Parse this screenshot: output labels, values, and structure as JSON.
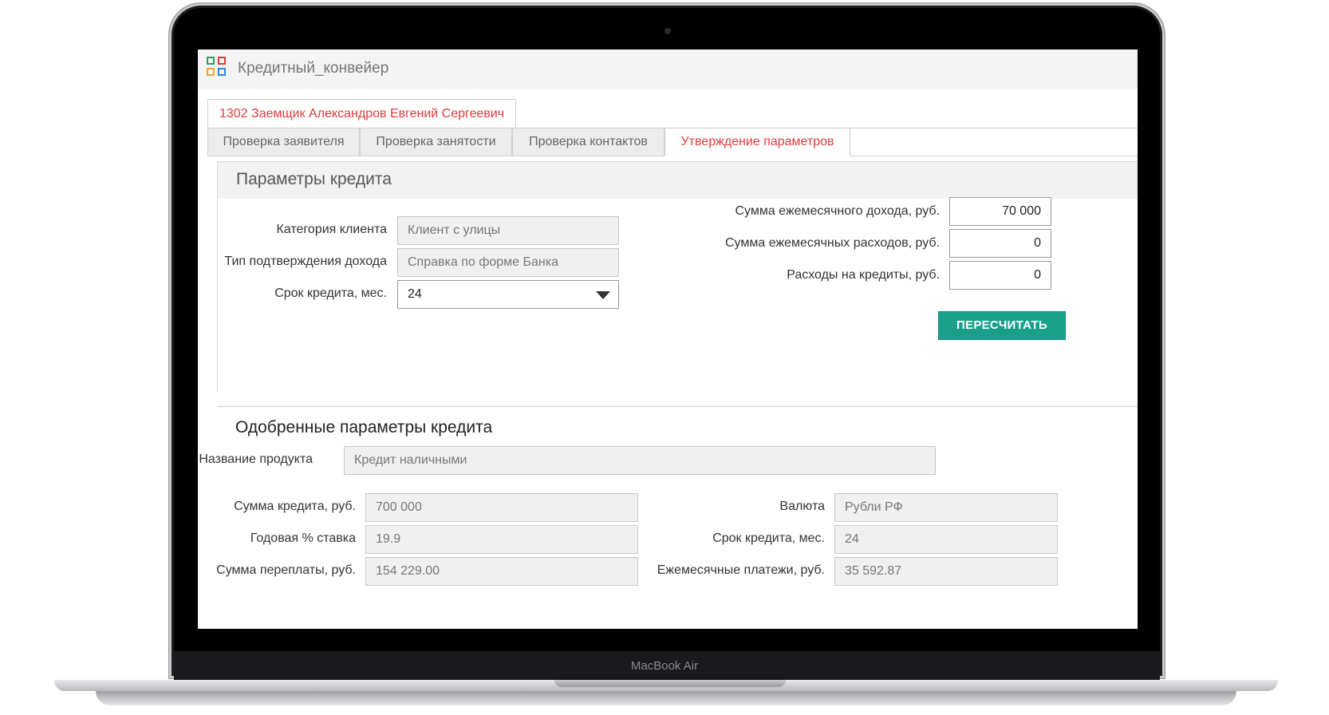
{
  "device": {
    "label": "MacBook Air"
  },
  "app": {
    "title": "Кредитный_конвейер",
    "logo_colors": [
      "#2e9e5b",
      "#e23b3b",
      "#f0a72b",
      "#2b88d8"
    ]
  },
  "record_tab": "1302 Заемщик Александров Евгений Сергеевич",
  "tabs": [
    {
      "label": "Проверка заявителя",
      "active": false
    },
    {
      "label": "Проверка занятости",
      "active": false
    },
    {
      "label": "Проверка контактов",
      "active": false
    },
    {
      "label": "Утверждение параметров",
      "active": true
    }
  ],
  "credit_params": {
    "title": "Параметры кредита",
    "client_category": {
      "label": "Категория клиента",
      "value": "Клиент с улицы"
    },
    "income_confirmation": {
      "label": "Тип подтверждения дохода",
      "value": "Справка по форме Банка"
    },
    "term": {
      "label": "Срок кредита, мес.",
      "value": "24"
    },
    "monthly_income": {
      "label": "Сумма ежемесячного дохода, руб.",
      "value": "70 000"
    },
    "monthly_expenses": {
      "label": "Сумма ежемесячных расходов, руб.",
      "value": "0"
    },
    "credit_expenses": {
      "label": "Расходы на кредиты, руб.",
      "value": "0"
    },
    "recalc_label": "ПЕРЕСЧИТАТЬ"
  },
  "approved": {
    "title": "Одобренные параметры кредита",
    "product": {
      "label": "Название продукта",
      "value": "Кредит наличными"
    },
    "amount": {
      "label": "Сумма кредита, руб.",
      "value": "700 000"
    },
    "rate": {
      "label": "Годовая % ставка",
      "value": "19.9"
    },
    "overpay": {
      "label": "Сумма переплаты, руб.",
      "value": "154 229.00"
    },
    "currency": {
      "label": "Валюта",
      "value": "Рубли РФ"
    },
    "term": {
      "label": "Срок кредита, мес.",
      "value": "24"
    },
    "monthly_payment": {
      "label": "Ежемесячные платежи, руб.",
      "value": "35 592.87"
    }
  },
  "colors": {
    "accent_red": "#e03a3a",
    "button_green": "#1aa08a"
  }
}
